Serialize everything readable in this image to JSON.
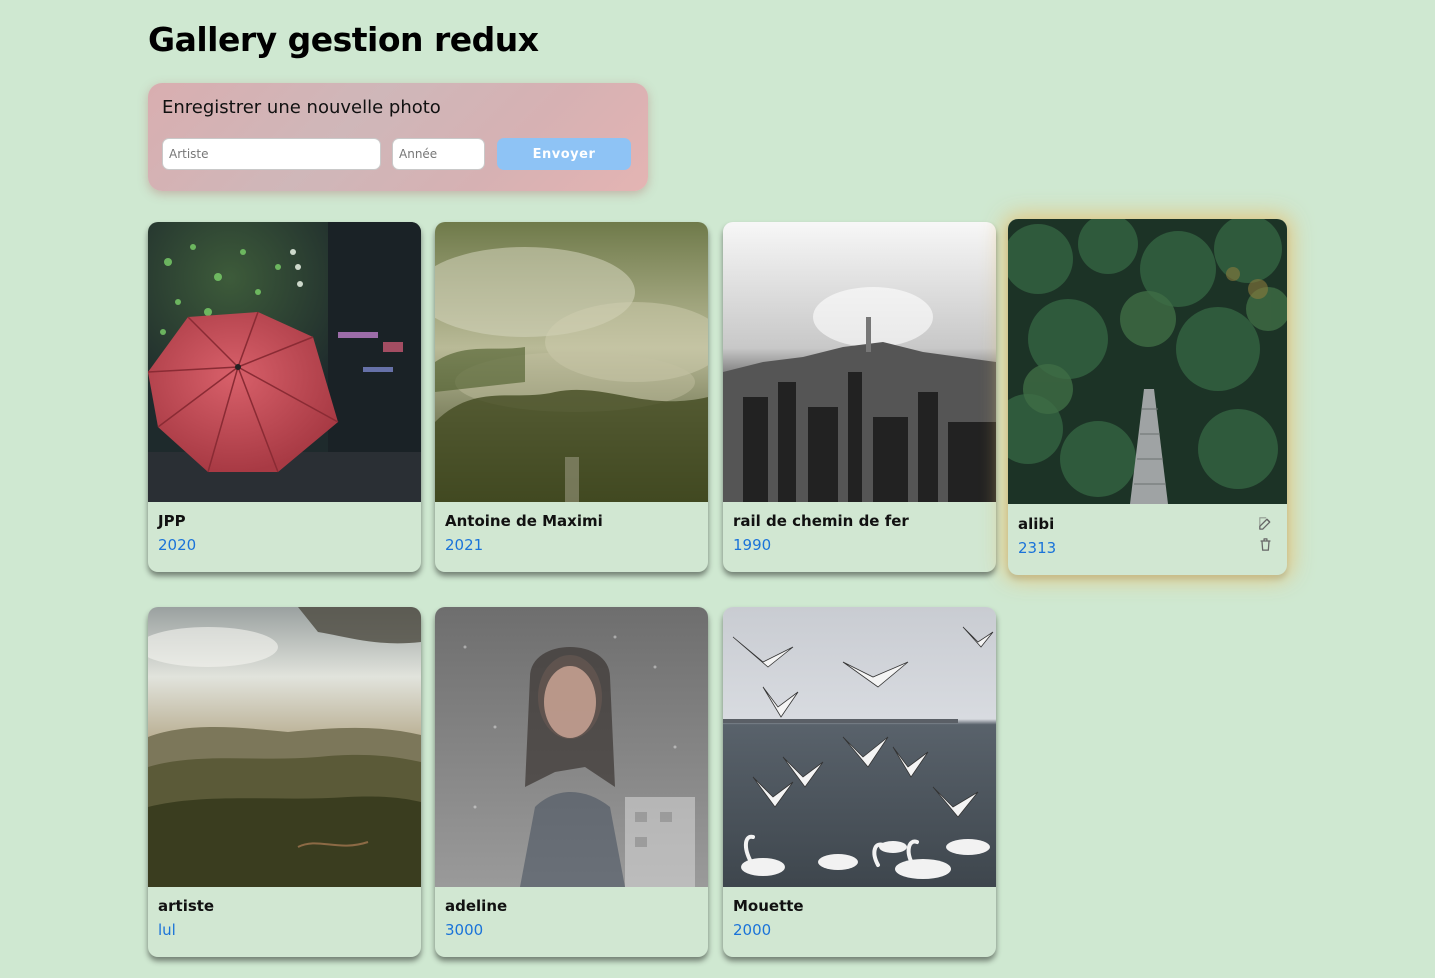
{
  "page": {
    "title": "Gallery gestion redux"
  },
  "form": {
    "title": "Enregistrer une nouvelle photo",
    "artist_placeholder": "Artiste",
    "artist_value": "",
    "year_placeholder": "Année",
    "year_value": "",
    "submit_label": "Envoyer"
  },
  "cards": [
    {
      "artist": "JPP",
      "year": "2020",
      "image": "red umbrella in rainy night street"
    },
    {
      "artist": "Antoine de Maximi",
      "year": "2021",
      "image": "misty foggy landscape"
    },
    {
      "artist": "rail de chemin de fer",
      "year": "1990",
      "image": "black and white city skyline"
    },
    {
      "artist": "alibi",
      "year": "2313",
      "image": "dark forest with bridge",
      "highlighted": true
    },
    {
      "artist": "artiste",
      "year": "lul",
      "image": "mountain landscape with cloudy sky"
    },
    {
      "artist": "adeline",
      "year": "3000",
      "image": "woman behind rainy window"
    },
    {
      "artist": "Mouette",
      "year": "2000",
      "image": "seagulls and swans over the sea"
    }
  ],
  "colors": {
    "background": "#cfe8d1",
    "year_text": "#1a73d9",
    "submit_button": "#8ec3f5",
    "highlight_glow": "#e6be6e"
  },
  "icons": {
    "edit": "edit-icon",
    "delete": "trash-icon"
  }
}
